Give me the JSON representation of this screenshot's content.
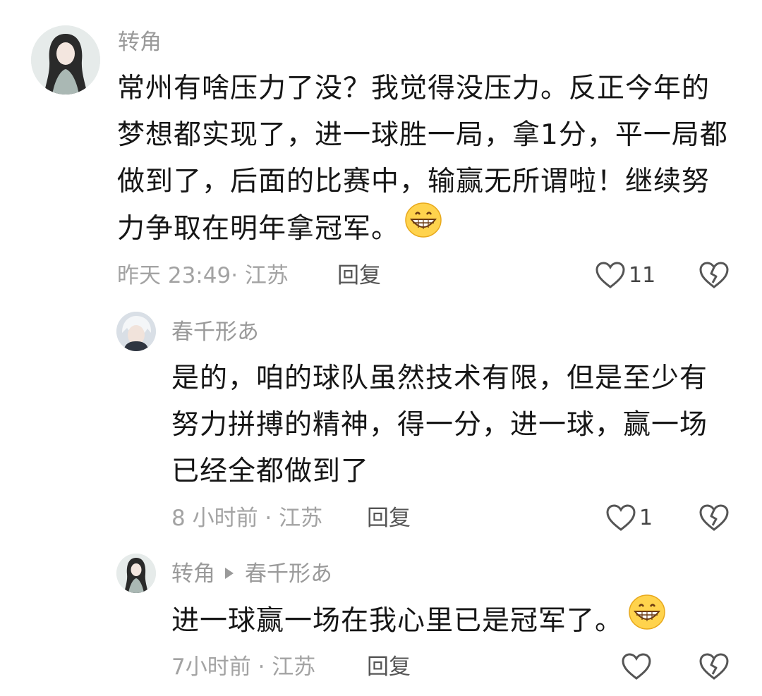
{
  "comments": [
    {
      "author": "转角",
      "lines": [
        "常州有啥压力了没？我觉得没压力。反正今年的",
        "梦想都实现了，进一球胜一局，拿1分，平一局都",
        "做到了，后面的比赛中，输赢无所谓啦！继续努",
        "力争取在明年拿冠军。"
      ],
      "emoji": "grinning-face-emoji",
      "time": "昨天 23:49· 江苏",
      "reply_label": "回复",
      "likes": "11"
    },
    {
      "author": "春千形あ",
      "lines": [
        "是的，咱的球队虽然技术有限，但是至少有",
        "努力拼搏的精神，得一分，进一球，赢一场",
        "已经全都做到了"
      ],
      "time": "8 小时前 · 江苏",
      "reply_label": "回复",
      "likes": "1"
    },
    {
      "author": "转角",
      "reply_to": "春千形あ",
      "lines": [
        "进一球赢一场在我心里已是冠军了。"
      ],
      "emoji": "grinning-face-emoji",
      "time": "7小时前 · 江苏",
      "reply_label": "回复",
      "likes": ""
    }
  ],
  "colors": {
    "name": "#9a9a9a",
    "text": "#161616",
    "meta": "#a3a3a3",
    "icon": "#555555"
  }
}
